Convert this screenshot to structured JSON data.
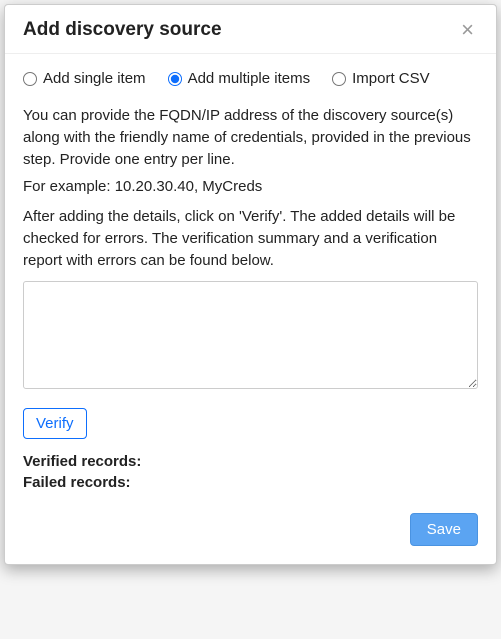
{
  "header": {
    "title": "Add discovery source",
    "close_glyph": "×"
  },
  "radios": {
    "single": {
      "label": "Add single item",
      "checked": false
    },
    "multiple": {
      "label": "Add multiple items",
      "checked": true
    },
    "import": {
      "label": "Import CSV",
      "checked": false
    }
  },
  "description": {
    "para1": "You can provide the FQDN/IP address of the discovery source(s) along with the friendly name of credentials, provided in the previous step. Provide one entry per line.",
    "example": "For example: 10.20.30.40, MyCreds",
    "para2": "After adding the details, click on 'Verify'. The added details will be checked for errors. The verification summary and a verification report with errors can be found below."
  },
  "textarea_value": "",
  "buttons": {
    "verify": "Verify",
    "save": "Save"
  },
  "records": {
    "verified_label": "Verified records:",
    "verified_value": "",
    "failed_label": "Failed records:",
    "failed_value": ""
  }
}
